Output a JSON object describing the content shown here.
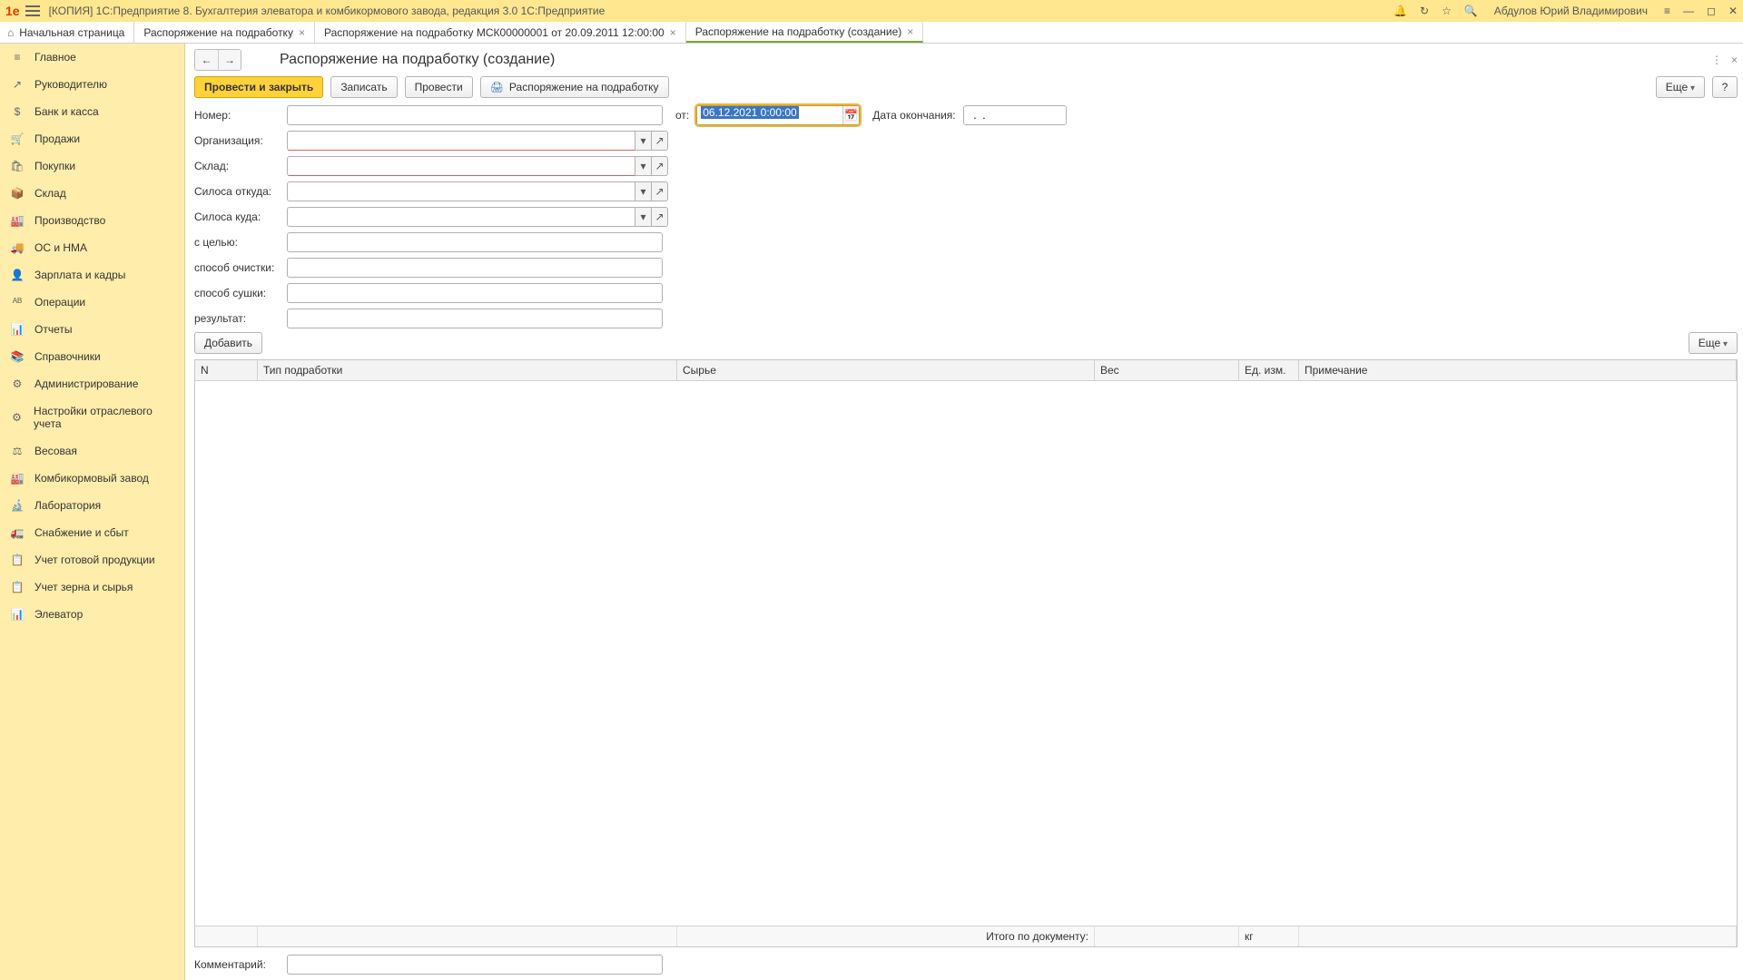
{
  "titlebar": {
    "logo": "1e",
    "title": "[КОПИЯ] 1С:Предприятие 8. Бухгалтерия элеватора и комбикормового завода, редакция 3.0 1С:Предприятие",
    "user": "Абдулов Юрий Владимирович"
  },
  "tabs": [
    {
      "label": "Начальная страница",
      "closable": false,
      "home": true
    },
    {
      "label": "Распоряжение на подработку",
      "closable": true
    },
    {
      "label": "Распоряжение на подработку МСК00000001 от 20.09.2011 12:00:00",
      "closable": true
    },
    {
      "label": "Распоряжение на подработку (создание)",
      "closable": true,
      "active": true
    }
  ],
  "sidebar": {
    "items": [
      {
        "label": "Главное",
        "icon": "≡"
      },
      {
        "label": "Руководителю",
        "icon": "↗"
      },
      {
        "label": "Банк и касса",
        "icon": "$"
      },
      {
        "label": "Продажи",
        "icon": "🛒"
      },
      {
        "label": "Покупки",
        "icon": "🛍"
      },
      {
        "label": "Склад",
        "icon": "📦"
      },
      {
        "label": "Производство",
        "icon": "🏭"
      },
      {
        "label": "ОС и НМА",
        "icon": "🚚"
      },
      {
        "label": "Зарплата и кадры",
        "icon": "👤"
      },
      {
        "label": "Операции",
        "icon": "ᴬᴮ"
      },
      {
        "label": "Отчеты",
        "icon": "📊"
      },
      {
        "label": "Справочники",
        "icon": "📚"
      },
      {
        "label": "Администрирование",
        "icon": "⚙"
      },
      {
        "label": "Настройки отраслевого учета",
        "icon": "⚙"
      },
      {
        "label": "Весовая",
        "icon": "⚖"
      },
      {
        "label": "Комбикормовый завод",
        "icon": "🏭"
      },
      {
        "label": "Лаборатория",
        "icon": "🔬"
      },
      {
        "label": "Снабжение и сбыт",
        "icon": "🚛"
      },
      {
        "label": "Учет готовой продукции",
        "icon": "📋"
      },
      {
        "label": "Учет зерна и сырья",
        "icon": "📋"
      },
      {
        "label": "Элеватор",
        "icon": "📊"
      }
    ]
  },
  "page": {
    "title": "Распоряжение на подработку (создание)"
  },
  "toolbar": {
    "post_and_close": "Провести и закрыть",
    "save": "Записать",
    "post": "Провести",
    "print": "Распоряжение на подработку",
    "more": "Еще",
    "help": "?"
  },
  "form": {
    "labels": {
      "number": "Номер:",
      "from": "от:",
      "end_date": "Дата окончания:",
      "organization": "Организация:",
      "warehouse": "Склад:",
      "silo_from": "Силоса откуда:",
      "silo_to": "Силоса куда:",
      "purpose": "с целью:",
      "cleaning": "способ очистки:",
      "drying": "способ сушки:",
      "result": "результат:",
      "comment": "Комментарий:"
    },
    "values": {
      "number": "",
      "date_from": "06.12.2021 0:00:00",
      "end_date": "  .  .    ",
      "organization": "",
      "warehouse": "",
      "silo_from": "",
      "silo_to": "",
      "purpose": "",
      "cleaning": "",
      "drying": "",
      "result": "",
      "comment": ""
    },
    "add": "Добавить",
    "more2": "Еще"
  },
  "table": {
    "columns": {
      "n": "N",
      "type": "Тип подработки",
      "raw": "Сырье",
      "weight": "Вес",
      "unit": "Ед. изм.",
      "note": "Примечание"
    },
    "footer": {
      "total_label": "Итого по документу:",
      "unit": "кг"
    }
  }
}
